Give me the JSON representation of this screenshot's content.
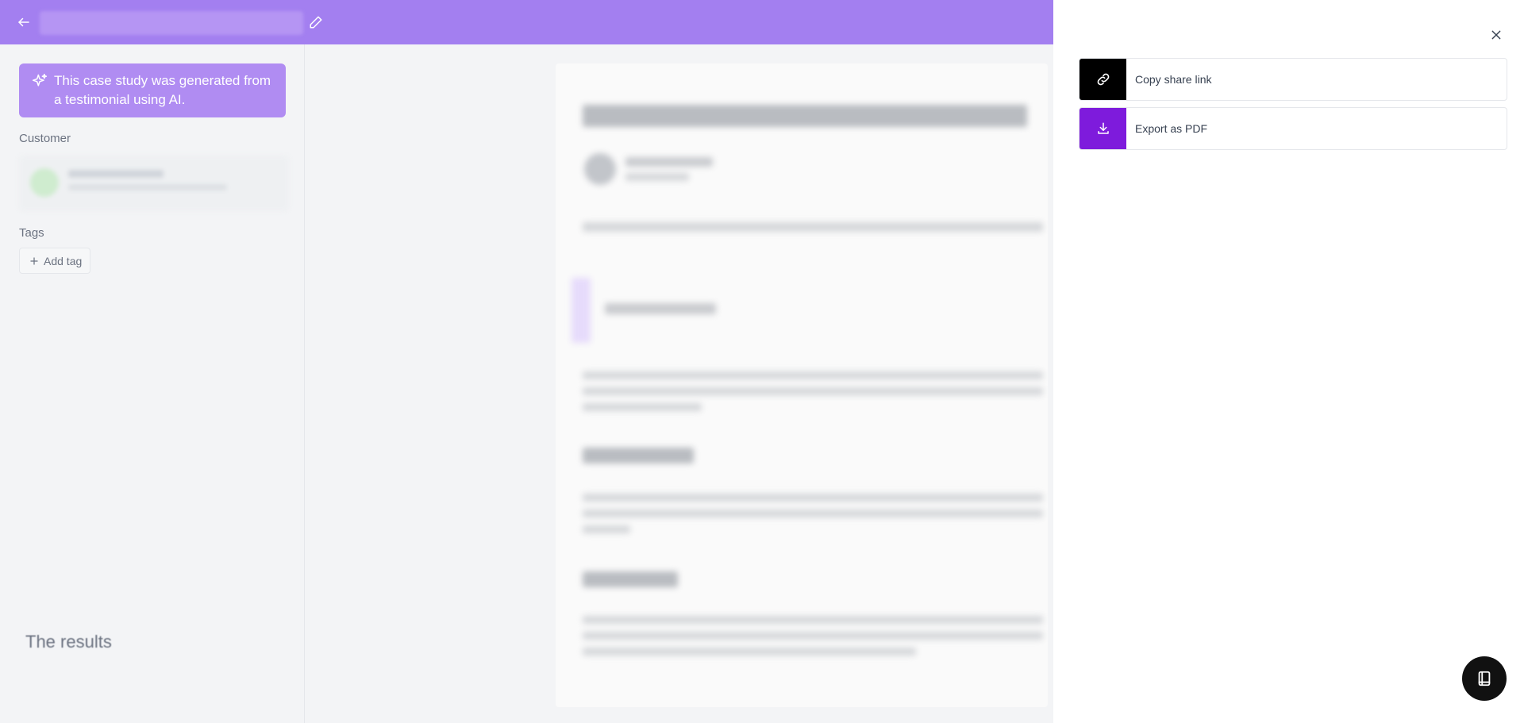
{
  "colors": {
    "topbar": "#a37ff0",
    "ai_banner": "#b08cf2",
    "link_icon_bg": "#000000",
    "pdf_icon_bg": "#7e1bdc"
  },
  "header": {
    "back_icon": "arrow-left-icon",
    "edit_icon": "pencil-icon"
  },
  "sidebar": {
    "ai_notice": "This case study was generated from a testimonial using AI.",
    "customer_label": "Customer",
    "tags_label": "Tags",
    "add_tag_label": "Add tag"
  },
  "document": {
    "visible_heading": "The results"
  },
  "share_panel": {
    "close_icon": "close-icon",
    "actions": [
      {
        "label": "Copy share link",
        "icon": "link-icon"
      },
      {
        "label": "Export as PDF",
        "icon": "download-icon"
      }
    ]
  },
  "fab_icon": "book-icon"
}
